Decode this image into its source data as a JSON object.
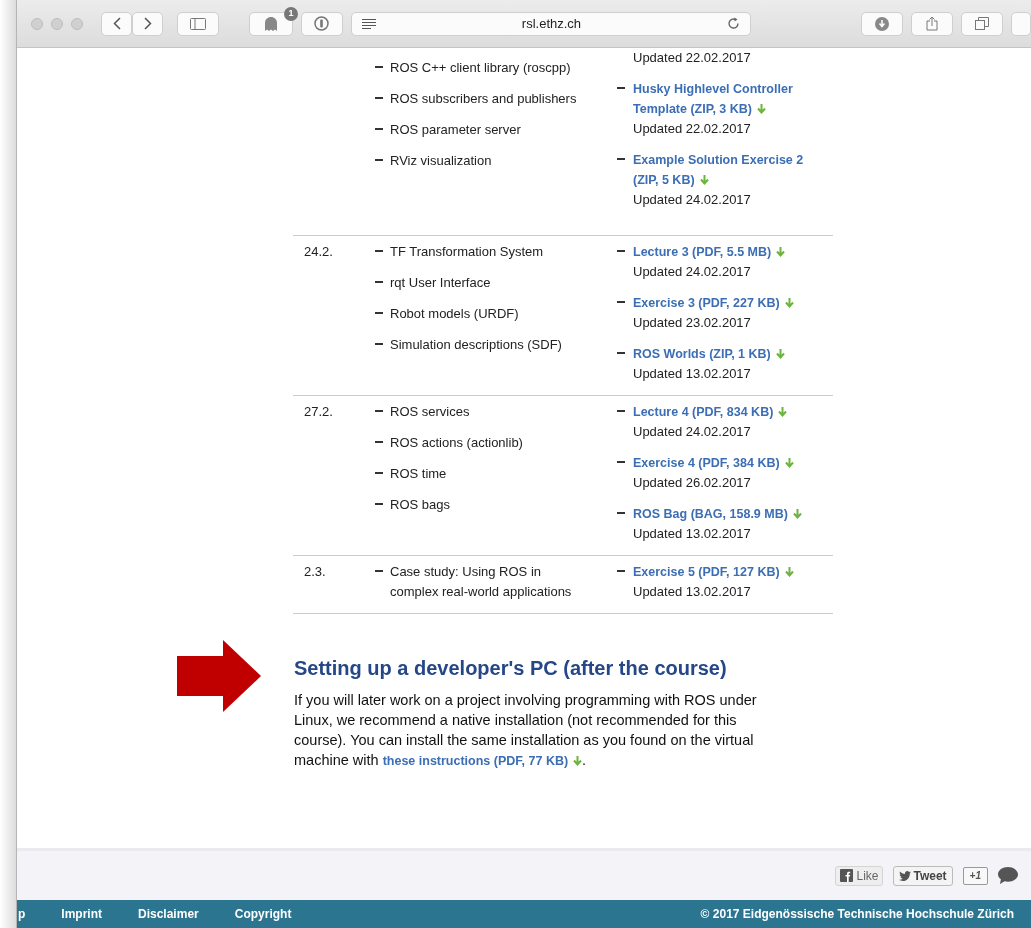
{
  "browser": {
    "url": "rsl.ethz.ch",
    "extension_badge": "1"
  },
  "table": {
    "rows": [
      {
        "topics": [
          "ROS C++ client library (roscpp)",
          "ROS subscribers and publishers",
          "ROS parameter server",
          "RViz visualization"
        ],
        "materials": [
          {
            "updated": "Updated 22.02.2017"
          },
          {
            "link": "Husky Highlevel Controller Template (ZIP, 3 KB)",
            "updated": "Updated 22.02.2017"
          },
          {
            "link": "Example Solution Exercise 2 (ZIP, 5 KB)",
            "updated": "Updated 24.02.2017"
          }
        ]
      },
      {
        "date": "24.2.",
        "topics": [
          "TF Transformation System",
          "rqt User Interface",
          "Robot models (URDF)",
          "Simulation descriptions (SDF)"
        ],
        "materials": [
          {
            "link": "Lecture 3 (PDF, 5.5 MB)",
            "updated": "Updated 24.02.2017"
          },
          {
            "link": "Exercise 3 (PDF, 227 KB)",
            "updated": "Updated 23.02.2017"
          },
          {
            "link": "ROS Worlds (ZIP, 1 KB)",
            "updated": "Updated 13.02.2017"
          }
        ]
      },
      {
        "date": "27.2.",
        "topics": [
          "ROS services",
          "ROS actions (actionlib)",
          "ROS time",
          "ROS bags"
        ],
        "materials": [
          {
            "link": "Lecture 4 (PDF, 834 KB)",
            "updated": "Updated 24.02.2017"
          },
          {
            "link": "Exercise 4 (PDF, 384 KB)",
            "updated": "Updated 26.02.2017"
          },
          {
            "link": "ROS Bag (BAG, 158.9 MB)",
            "updated": "Updated 13.02.2017"
          }
        ]
      },
      {
        "date": "2.3.",
        "topics": [
          "Case study: Using ROS in complex real-world applications"
        ],
        "materials": [
          {
            "link": "Exercise 5 (PDF, 127 KB)",
            "updated": "Updated 13.02.2017"
          }
        ]
      }
    ]
  },
  "section": {
    "heading": "Setting up a developer's PC (after the course)",
    "text": "If you will later work on a project involving programming with ROS under Linux, we recommend a native installation (not recommended for this course). You can install the same installation as you found on the virtual machine with ",
    "link": "these instructions (PDF, 77 KB)",
    "text_end": "."
  },
  "social": [
    {
      "kind": "like",
      "label": "Like"
    },
    {
      "kind": "tweet",
      "label": "Tweet"
    },
    {
      "kind": "plusone",
      "label": "+1"
    },
    {
      "kind": "comment"
    }
  ],
  "footer": {
    "links": [
      "p",
      "Imprint",
      "Disclaimer",
      "Copyright"
    ],
    "copyright": "© 2017 Eidgenössische Technische Hochschule Zürich"
  }
}
